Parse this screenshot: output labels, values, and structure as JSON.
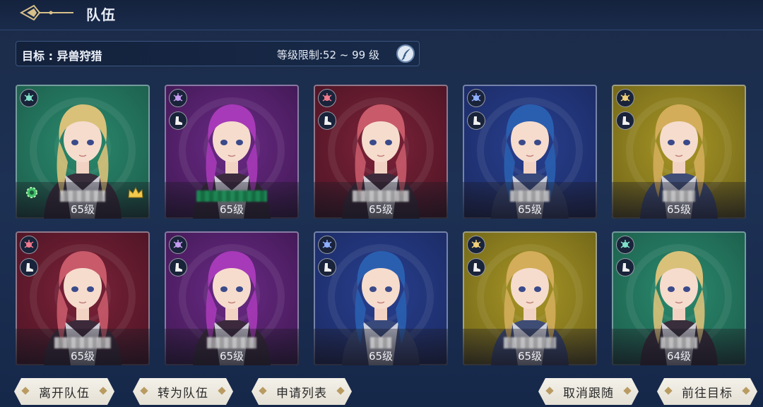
{
  "header": {
    "title": "队伍"
  },
  "goal": {
    "text": "目标 : 异兽狩猎",
    "level_limit": "等级限制:52 ~ 99 级"
  },
  "colors": {
    "green": "#2a8a6d",
    "purple": "#6b2a86",
    "crimson": "#7c2238",
    "blue": "#283f8f",
    "gold": "#a89626"
  },
  "members": [
    {
      "level": "65级",
      "bg": "green",
      "faction_icon": "beetle-icon",
      "role_icon": "",
      "leader": true
    },
    {
      "level": "65级",
      "bg": "purple",
      "faction_icon": "beast-icon",
      "role_icon": "boot-icon",
      "leader": false
    },
    {
      "level": "65级",
      "bg": "crimson",
      "faction_icon": "dragon-icon",
      "role_icon": "boot-icon",
      "leader": false
    },
    {
      "level": "65级",
      "bg": "blue",
      "faction_icon": "serpent-icon",
      "role_icon": "boot-icon",
      "leader": false
    },
    {
      "level": "65级",
      "bg": "gold",
      "faction_icon": "owl-icon",
      "role_icon": "boot-icon",
      "leader": false
    },
    {
      "level": "65级",
      "bg": "crimson",
      "faction_icon": "dragon-icon",
      "role_icon": "boot-icon",
      "leader": false
    },
    {
      "level": "65级",
      "bg": "purple",
      "faction_icon": "beast-icon",
      "role_icon": "boot-icon",
      "leader": false
    },
    {
      "level": "65级",
      "bg": "blue",
      "faction_icon": "serpent-icon",
      "role_icon": "boot-icon",
      "leader": false
    },
    {
      "level": "65级",
      "bg": "gold",
      "faction_icon": "owl-icon",
      "role_icon": "boot-icon",
      "leader": false
    },
    {
      "level": "64级",
      "bg": "green",
      "faction_icon": "beetle-icon",
      "role_icon": "boot-icon",
      "leader": false
    }
  ],
  "buttons": {
    "leave_team": "离开队伍",
    "convert_team": "转为队伍",
    "apply_list": "申请列表",
    "cancel_follow": "取消跟随",
    "go_to_target": "前往目标"
  }
}
